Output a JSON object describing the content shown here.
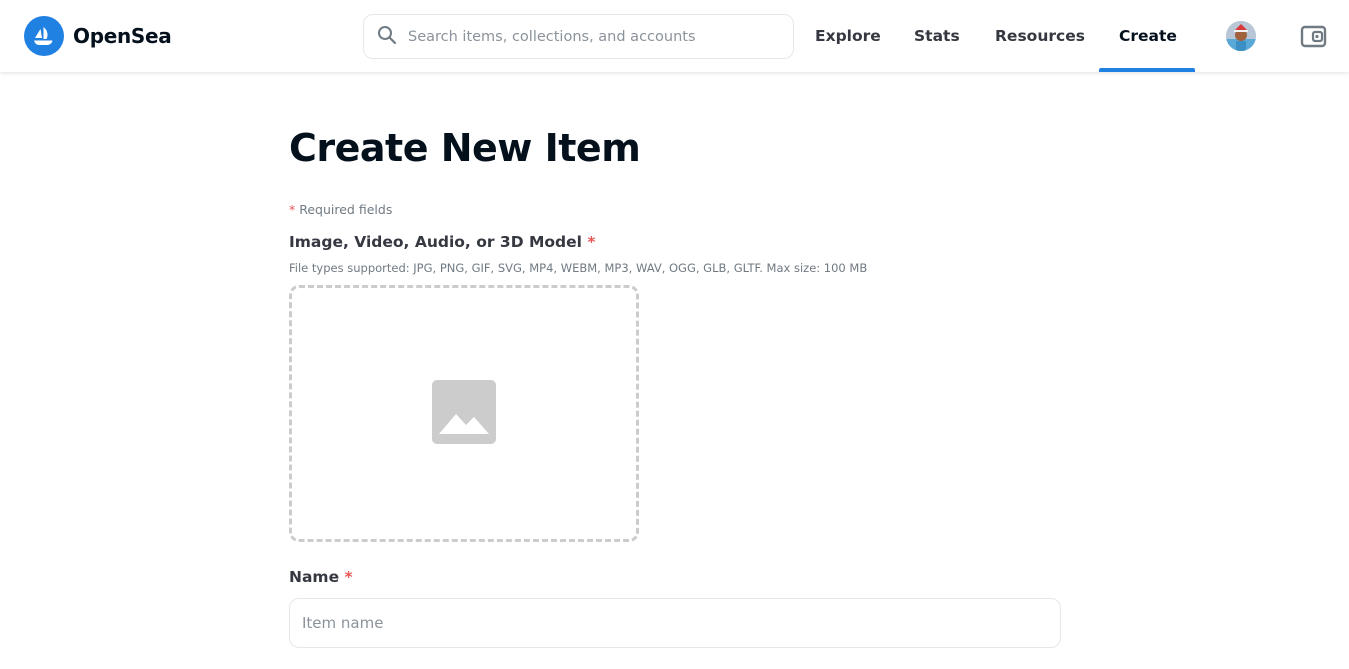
{
  "brand": {
    "name": "OpenSea",
    "color": "#2081e2"
  },
  "search": {
    "placeholder": "Search items, collections, and accounts",
    "icon": "search-icon"
  },
  "nav": {
    "items": [
      {
        "label": "Explore"
      },
      {
        "label": "Stats"
      },
      {
        "label": "Resources"
      },
      {
        "label": "Create",
        "active": true
      }
    ]
  },
  "page": {
    "title": "Create New Item",
    "required_star": "*",
    "required_note": "Required fields",
    "media": {
      "label": "Image, Video, Audio, or 3D Model",
      "star": "*",
      "help": "File types supported: JPG, PNG, GIF, SVG, MP4, WEBM, MP3, WAV, OGG, GLB, GLTF. Max size: 100 MB",
      "icon": "image-placeholder-icon"
    },
    "name_field": {
      "label": "Name",
      "star": "*",
      "placeholder": "Item name",
      "value": ""
    }
  }
}
